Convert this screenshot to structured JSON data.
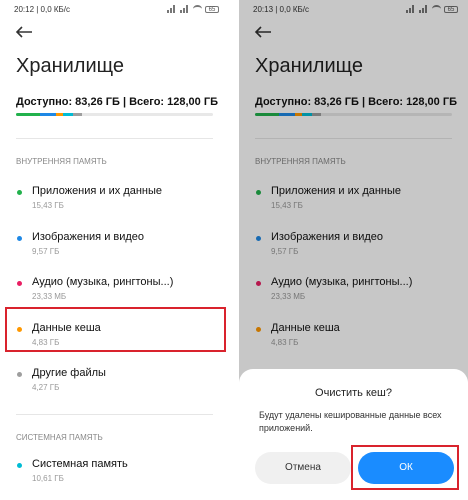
{
  "left": {
    "status": {
      "time": "20:12 | 0,0 КБ/с",
      "battery": "65"
    },
    "title": "Хранилище",
    "available": "Доступно: 83,26 ГБ | Всего: 128,00 ГБ",
    "internal_section": "ВНУТРЕННЯЯ ПАМЯТЬ",
    "items": [
      {
        "name": "Приложения и их данные",
        "size": "15,43 ГБ",
        "color": "#22b14c"
      },
      {
        "name": "Изображения и видео",
        "size": "9,57 ГБ",
        "color": "#1e88e5"
      },
      {
        "name": "Аудио (музыка, рингтоны...)",
        "size": "23,33 МБ",
        "color": "#e91e63"
      },
      {
        "name": "Данные кеша",
        "size": "4,83 ГБ",
        "color": "#ff9800"
      },
      {
        "name": "Другие файлы",
        "size": "4,27 ГБ",
        "color": "#9e9e9e"
      }
    ],
    "system_section": "СИСТЕМНАЯ ПАМЯТЬ",
    "system_item": {
      "name": "Системная память",
      "size": "10,61 ГБ",
      "color": "#00bcd4"
    }
  },
  "right": {
    "status": {
      "time": "20:13 | 0,0 КБ/с",
      "battery": "65"
    },
    "title": "Хранилище",
    "available": "Доступно: 83,26 ГБ | Всего: 128,00 ГБ",
    "internal_section": "ВНУТРЕННЯЯ ПАМЯТЬ",
    "items": [
      {
        "name": "Приложения и их данные",
        "size": "15,43 ГБ",
        "color": "#22b14c"
      },
      {
        "name": "Изображения и видео",
        "size": "9,57 ГБ",
        "color": "#1e88e5"
      },
      {
        "name": "Аудио (музыка, рингтоны...)",
        "size": "23,33 МБ",
        "color": "#e91e63"
      },
      {
        "name": "Данные кеша",
        "size": "4,83 ГБ",
        "color": "#ff9800"
      }
    ],
    "dialog": {
      "title": "Очистить кеш?",
      "message": "Будут удалены кешированные данные всех приложений.",
      "cancel": "Отмена",
      "ok": "ОК"
    }
  },
  "colors": {
    "accent": "#1a8cff",
    "highlight": "#d9232d"
  }
}
